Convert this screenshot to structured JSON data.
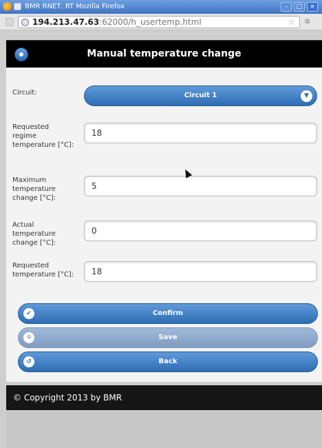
{
  "browser": {
    "window_title": "BMR RNET, RT   Mozilla Firefox",
    "min_glyph": "–",
    "max_glyph": "□",
    "close_glyph": "×",
    "url_host": "194.213.47.63",
    "url_path": ":62000/h_usertemp.html",
    "star_glyph": "☆",
    "extension_glyph": "✲"
  },
  "header": {
    "title": "Manual temperature change"
  },
  "form": {
    "circuit_label": "Circuit:",
    "circuit_value": "Circuit 1",
    "requested_regime_label": "Requested regime temperature [°C]:",
    "requested_regime_value": "18",
    "max_change_label": "Maximum temperature change [°C]:",
    "max_change_value": "5",
    "actual_change_label": "Actual temperature change [°C]:",
    "actual_change_value": "0",
    "requested_temp_label": "Requested temperature [°C]:",
    "requested_temp_value": "18"
  },
  "actions": {
    "confirm_label": "Confirm",
    "save_label": "Save",
    "back_label": "Back"
  },
  "footer": {
    "copyright": "© Copyright 2013 by BMR"
  },
  "colors": {
    "accent": "#3a7bc8",
    "header_bg": "#000000",
    "footer_bg": "#161616"
  }
}
